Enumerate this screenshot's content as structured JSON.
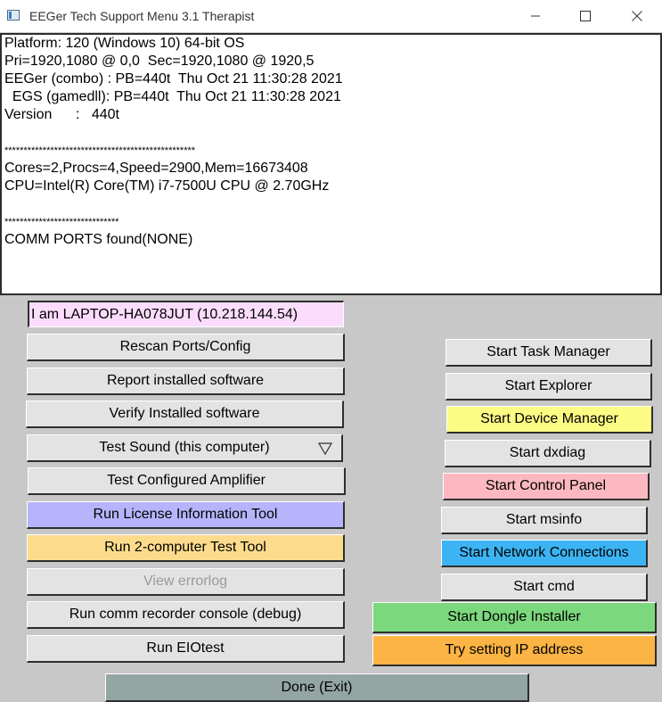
{
  "window": {
    "title": "EEGer Tech Support Menu 3.1 Therapist"
  },
  "info_lines": [
    "Platform: 120 (Windows 10) 64-bit OS",
    "Pri=1920,1080 @ 0,0  Sec=1920,1080 @ 1920,5",
    "EEGer (combo) : PB=440t  Thu Oct 21 11:30:28 2021",
    "  EGS (gamedll): PB=440t  Thu Oct 21 11:30:28 2021",
    "Version      :   440t",
    "",
    "**************************************************",
    "Cores=2,Procs=4,Speed=2900,Mem=16673408",
    "CPU=Intel(R) Core(TM) i7-7500U CPU @ 2.70GHz",
    "",
    "******************************",
    "COMM PORTS found(NONE)"
  ],
  "host_field": "I am LAPTOP-HA078JUT (10.218.144.54)",
  "left_buttons": {
    "rescan": "Rescan Ports/Config",
    "report": "Report installed software",
    "verify": "Verify Installed software",
    "test_sound": "Test Sound (this computer)",
    "test_amp": "Test Configured Amplifier",
    "license": "Run License Information Tool",
    "two_computer": "Run 2-computer Test Tool",
    "errorlog": "View errorlog",
    "comm_recorder": "Run comm recorder console (debug)",
    "eiotest": "Run EIOtest"
  },
  "right_buttons": {
    "task_manager": "Start Task Manager",
    "explorer": "Start  Explorer",
    "device_manager": "Start Device Manager",
    "dxdiag": "Start dxdiag",
    "control_panel": "Start Control Panel",
    "msinfo": "Start msinfo",
    "network": "Start Network Connections",
    "cmd": "Start cmd",
    "dongle": "Start Dongle Installer",
    "ip_address": "Try setting IP address"
  },
  "done_button": "Done (Exit)",
  "colors": {
    "background": "#c8c8c8",
    "button_default": "#e3e3e3",
    "host_field": "#fcdcfc",
    "license": "#b7b4fc",
    "two_computer": "#fcdc8c",
    "device_manager": "#fcfc84",
    "control_panel": "#fcb8c0",
    "network": "#3cb4f4",
    "dongle": "#7cd87c",
    "ip_address": "#fcb444",
    "done": "#94a6a4"
  }
}
